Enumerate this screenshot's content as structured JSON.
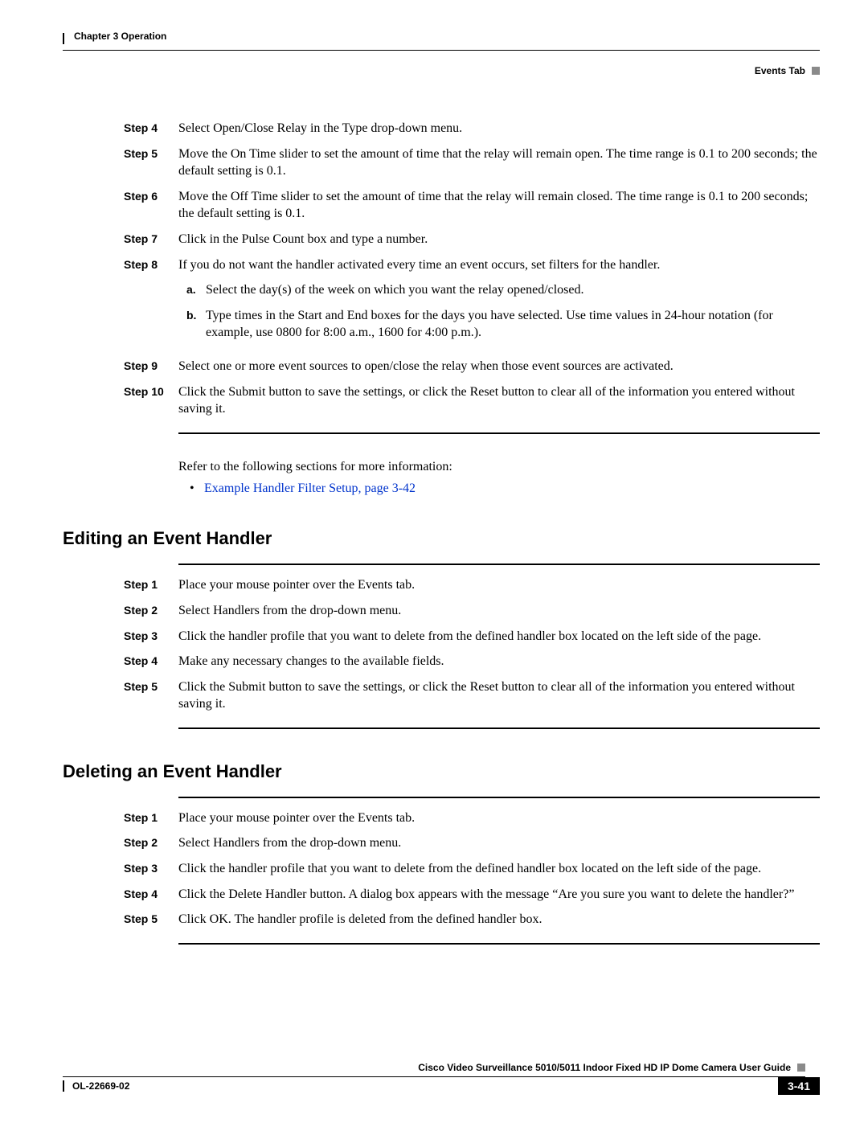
{
  "header": {
    "chapter": "Chapter 3      Operation",
    "section": "Events Tab"
  },
  "steps_a": [
    {
      "label": "Step 4",
      "text": "Select Open/Close Relay in the Type drop-down menu."
    },
    {
      "label": "Step 5",
      "text": "Move the On Time slider to set the amount of time that the relay will remain open. The time range is 0.1 to 200 seconds; the default setting is 0.1."
    },
    {
      "label": "Step 6",
      "text": "Move the Off Time slider to set the amount of time that the relay will remain closed. The time range is 0.1 to 200 seconds; the default setting is 0.1."
    },
    {
      "label": "Step 7",
      "text": "Click in the Pulse Count box and type a number."
    },
    {
      "label": "Step 8",
      "text": "If you do not want the handler activated every time an event occurs, set filters for the handler.",
      "subs": [
        {
          "label": "a.",
          "text": "Select the day(s) of the week on which you want the relay opened/closed."
        },
        {
          "label": "b.",
          "text": "Type times in the Start and End boxes for the days you have selected. Use time values in 24-hour notation (for example, use 0800 for 8:00 a.m., 1600 for 4:00 p.m.)."
        }
      ]
    },
    {
      "label": "Step 9",
      "text": "Select one or more event sources to open/close the relay when those event sources are activated."
    },
    {
      "label": "Step 10",
      "text": "Click the Submit button to save the settings, or click the Reset button to clear all of the information you entered without saving it."
    }
  ],
  "refer_text": "Refer to the following sections for more information:",
  "refer_link": "Example Handler Filter Setup, page 3-42",
  "heading_edit": "Editing an Event Handler",
  "steps_b": [
    {
      "label": "Step 1",
      "text": "Place your mouse pointer over the Events tab."
    },
    {
      "label": "Step 2",
      "text": "Select Handlers from the drop-down menu."
    },
    {
      "label": "Step 3",
      "text": "Click the handler profile that you want to delete from the defined handler box located on the left side of the page."
    },
    {
      "label": "Step 4",
      "text": "Make any necessary changes to the available fields."
    },
    {
      "label": "Step 5",
      "text": "Click the Submit button to save the settings, or click the Reset button to clear all of the information you entered without saving it."
    }
  ],
  "heading_delete": "Deleting an Event Handler",
  "steps_c": [
    {
      "label": "Step 1",
      "text": "Place your mouse pointer over the Events tab."
    },
    {
      "label": "Step 2",
      "text": "Select Handlers from the drop-down menu."
    },
    {
      "label": "Step 3",
      "text": "Click the handler profile that you want to delete from the defined handler box located on the left side of the page."
    },
    {
      "label": "Step 4",
      "text": "Click the Delete Handler button. A dialog box appears with the message “Are you sure you want to delete the handler?”"
    },
    {
      "label": "Step 5",
      "text": "Click OK. The handler profile is deleted from the defined handler box."
    }
  ],
  "footer": {
    "title": "Cisco Video Surveillance 5010/5011 Indoor Fixed HD IP Dome Camera User Guide",
    "doc_id": "OL-22669-02",
    "page": "3-41"
  }
}
